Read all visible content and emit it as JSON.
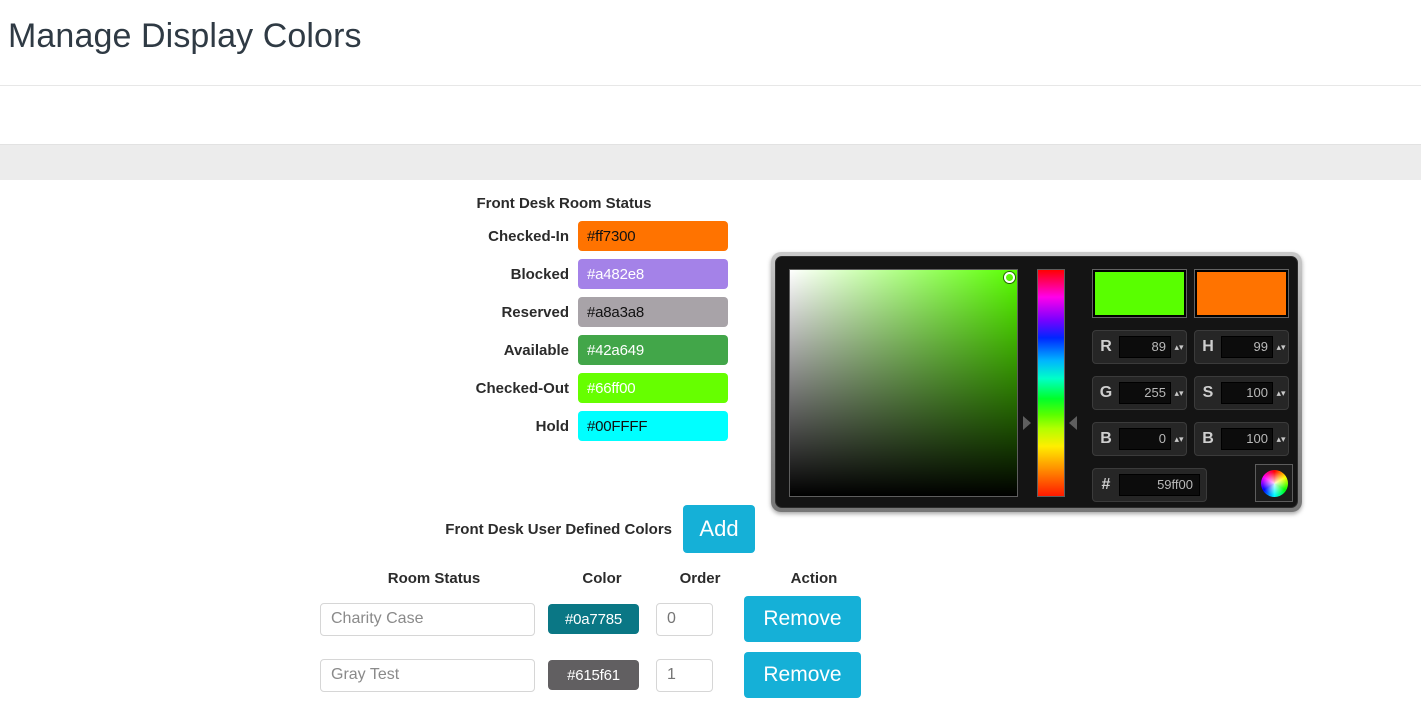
{
  "page": {
    "title": "Manage Display Colors"
  },
  "room_status": {
    "heading": "Front Desk Room Status",
    "rows": [
      {
        "label": "Checked-In",
        "value": "#ff7300",
        "bg": "#ff7300",
        "fg": "#111111"
      },
      {
        "label": "Blocked",
        "value": "#a482e8",
        "bg": "#a482e8",
        "fg": "#ffffff"
      },
      {
        "label": "Reserved",
        "value": "#a8a3a8",
        "bg": "#a8a3a8",
        "fg": "#111111"
      },
      {
        "label": "Available",
        "value": "#42a649",
        "bg": "#42a649",
        "fg": "#ffffff"
      },
      {
        "label": "Checked-Out",
        "value": "#66ff00",
        "bg": "#66ff00",
        "fg": "#ffffff"
      },
      {
        "label": "Hold",
        "value": "#00FFFF",
        "bg": "#00ffff",
        "fg": "#111111"
      }
    ]
  },
  "color_picker": {
    "new_color": "#59ff00",
    "old_color": "#ff7300",
    "fields": {
      "r_label": "R",
      "r_value": "89",
      "g_label": "G",
      "g_value": "255",
      "b_label": "B",
      "b_value": "0",
      "h_label": "H",
      "h_value": "99",
      "s_label": "S",
      "s_value": "100",
      "v_label": "B",
      "v_value": "100",
      "hex_label": "#",
      "hex_value": "59ff00"
    },
    "spinner_glyph": "▴▾"
  },
  "user_defined": {
    "heading": "Front Desk User Defined Colors",
    "add_label": "Add",
    "columns": {
      "status": "Room Status",
      "color": "Color",
      "order": "Order",
      "action": "Action"
    },
    "rows": [
      {
        "status": "Charity Case",
        "color": "#0a7785",
        "color_bg": "#0a7785",
        "color_fg": "#ffffff",
        "order": "0",
        "action": "Remove"
      },
      {
        "status": "Gray Test",
        "color": "#615f61",
        "color_bg": "#615f61",
        "color_fg": "#ffffff",
        "order": "1",
        "action": "Remove"
      }
    ]
  },
  "theme": {
    "accent": "#15b0d7",
    "title_color": "#2f3a44",
    "strip_bg": "#ececec"
  }
}
